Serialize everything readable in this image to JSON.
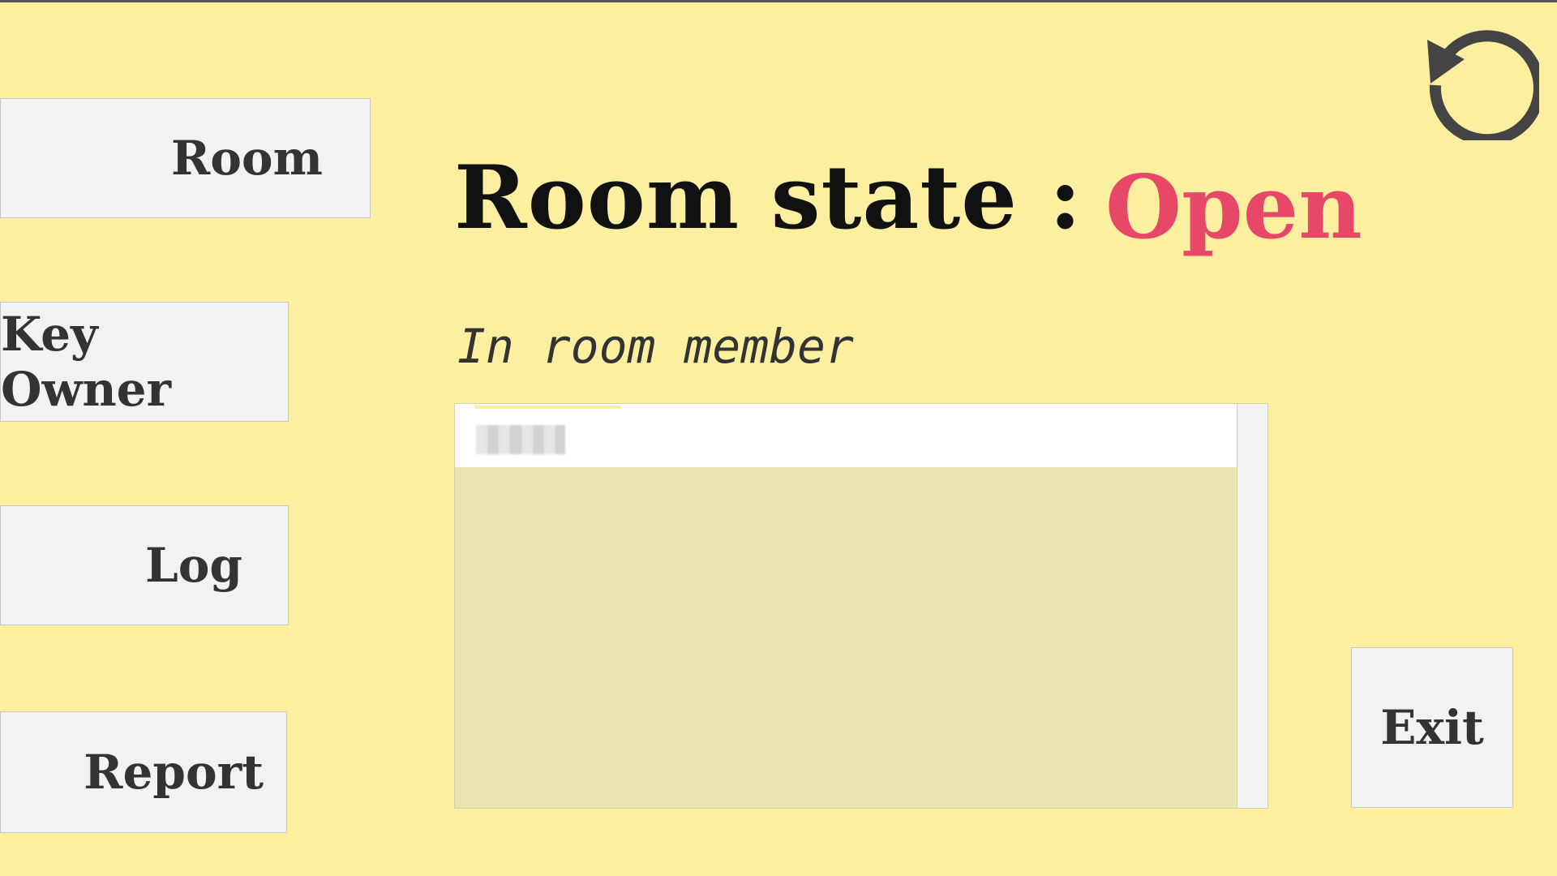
{
  "nav": {
    "room_label": "Room",
    "key_owner_label": "Key Owner",
    "log_label": "Log",
    "report_label": "Report"
  },
  "status": {
    "label": "Room state :",
    "value": "Open",
    "value_color": "#e84868"
  },
  "members": {
    "heading": "In room member",
    "rows": [
      ""
    ]
  },
  "actions": {
    "exit_label": "Exit",
    "refresh_icon": "refresh-icon"
  },
  "colors": {
    "background": "#fcf0a0",
    "button": "#f2f2f2",
    "list_background": "#ede5b0"
  }
}
